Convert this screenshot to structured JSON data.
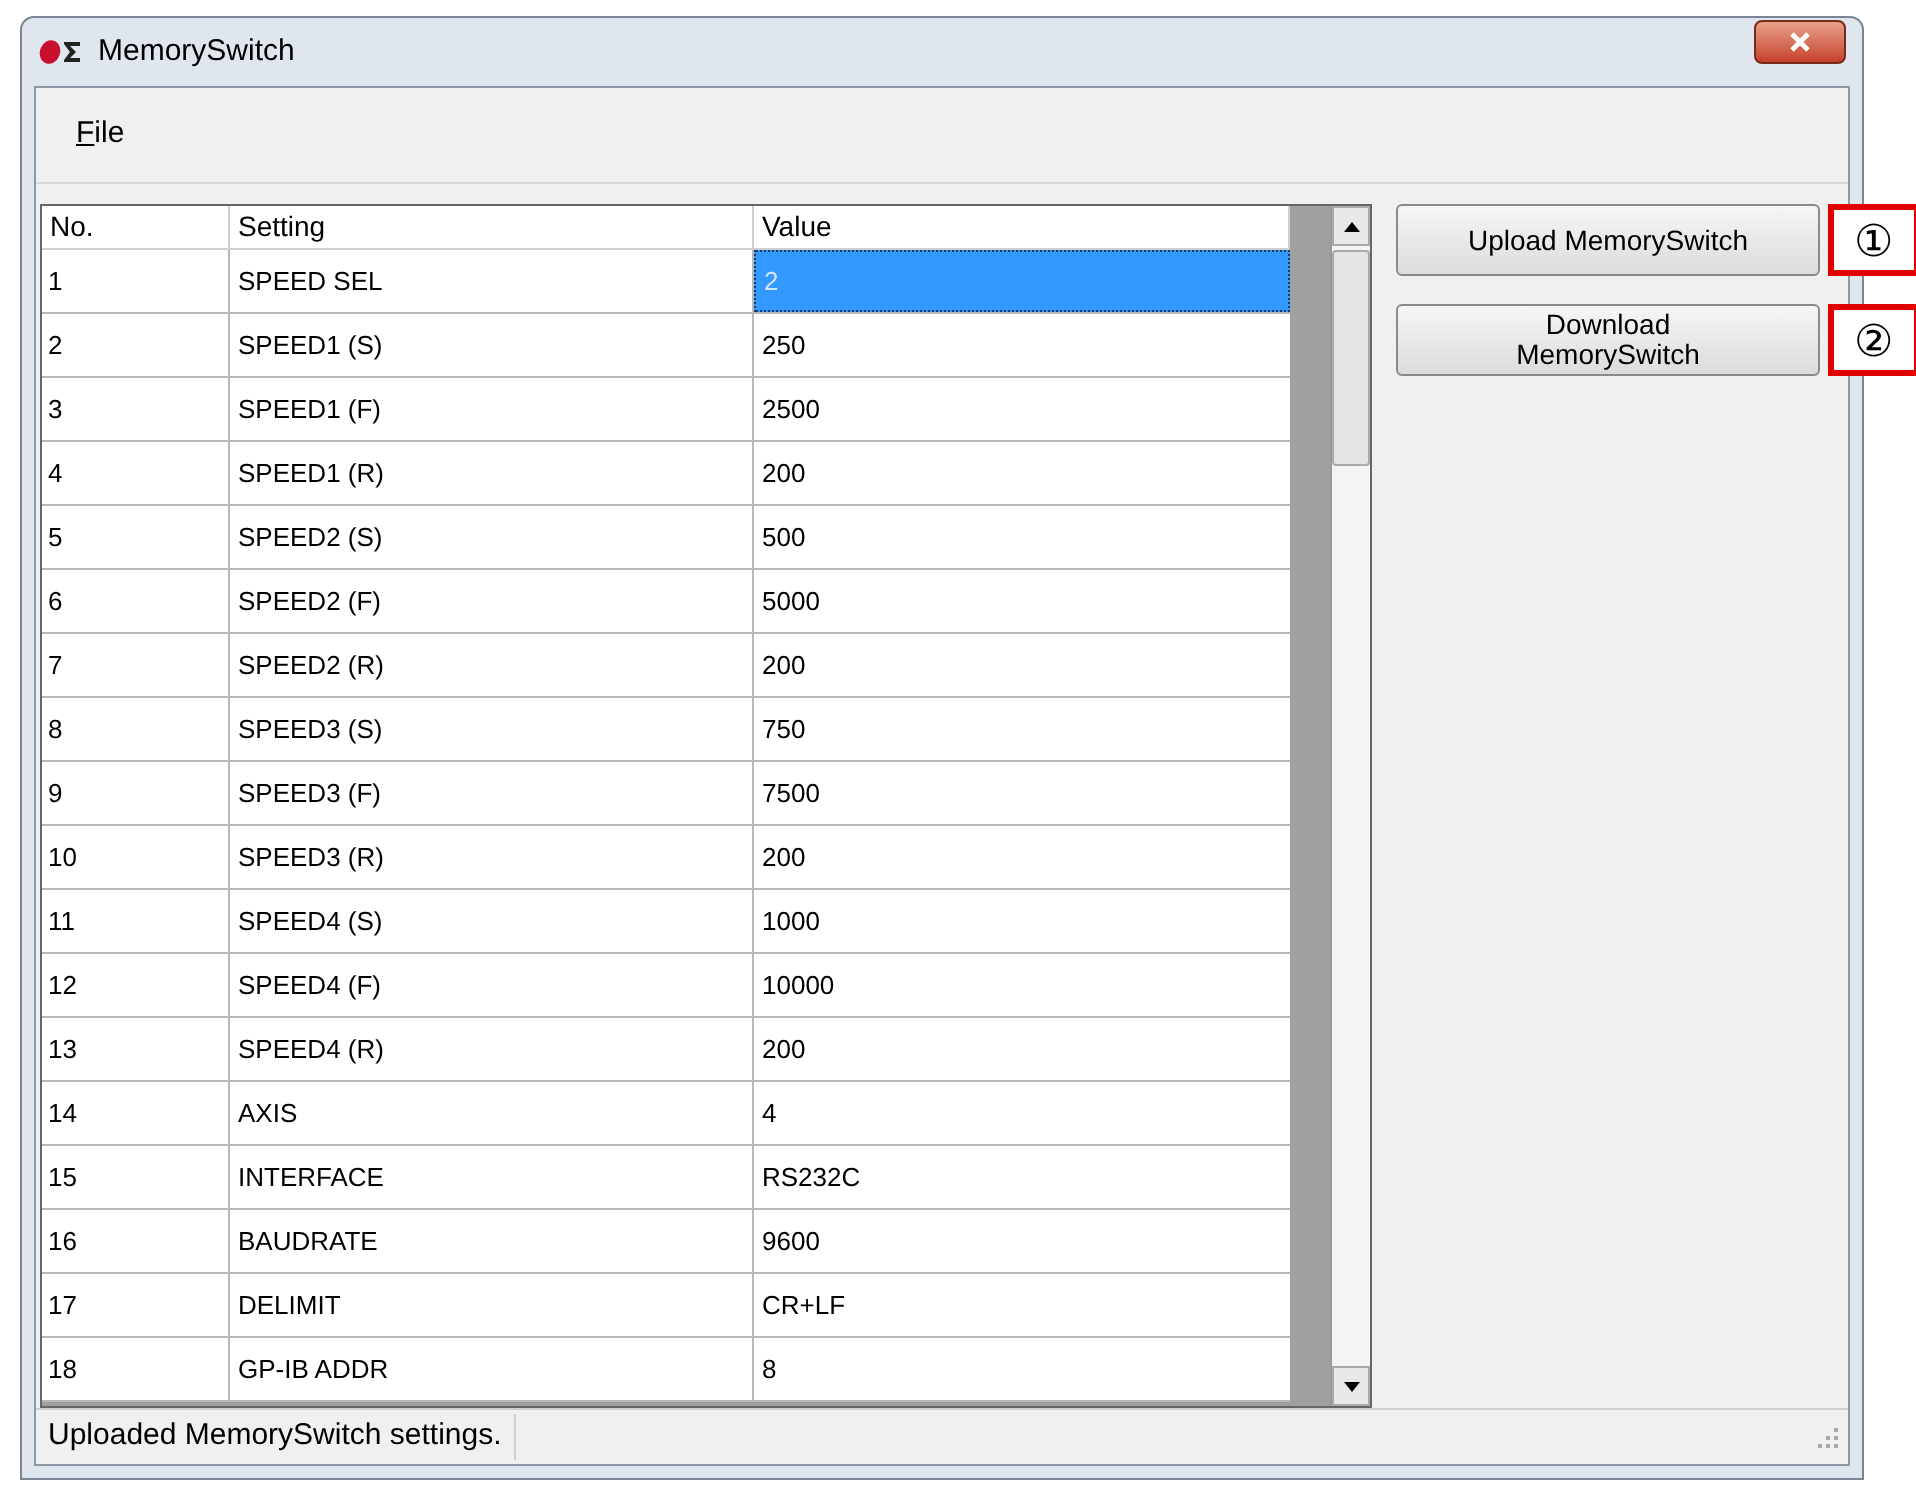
{
  "window": {
    "title": "MemorySwitch"
  },
  "menu": [
    {
      "label": "File"
    }
  ],
  "table": {
    "columns": [
      "No.",
      "Setting",
      "Value"
    ],
    "rows": [
      {
        "no": "1",
        "setting": "SPEED SEL",
        "value": "2",
        "selected": true
      },
      {
        "no": "2",
        "setting": "SPEED1 (S)",
        "value": "250",
        "selected": false
      },
      {
        "no": "3",
        "setting": "SPEED1 (F)",
        "value": "2500",
        "selected": false
      },
      {
        "no": "4",
        "setting": "SPEED1 (R)",
        "value": "200",
        "selected": false
      },
      {
        "no": "5",
        "setting": "SPEED2 (S)",
        "value": "500",
        "selected": false
      },
      {
        "no": "6",
        "setting": "SPEED2 (F)",
        "value": "5000",
        "selected": false
      },
      {
        "no": "7",
        "setting": "SPEED2 (R)",
        "value": "200",
        "selected": false
      },
      {
        "no": "8",
        "setting": "SPEED3 (S)",
        "value": "750",
        "selected": false
      },
      {
        "no": "9",
        "setting": "SPEED3 (F)",
        "value": "7500",
        "selected": false
      },
      {
        "no": "10",
        "setting": "SPEED3 (R)",
        "value": "200",
        "selected": false
      },
      {
        "no": "11",
        "setting": "SPEED4 (S)",
        "value": "1000",
        "selected": false
      },
      {
        "no": "12",
        "setting": "SPEED4 (F)",
        "value": "10000",
        "selected": false
      },
      {
        "no": "13",
        "setting": "SPEED4 (R)",
        "value": "200",
        "selected": false
      },
      {
        "no": "14",
        "setting": "AXIS",
        "value": "4",
        "selected": false
      },
      {
        "no": "15",
        "setting": "INTERFACE",
        "value": "RS232C",
        "selected": false
      },
      {
        "no": "16",
        "setting": "BAUDRATE",
        "value": "9600",
        "selected": false
      },
      {
        "no": "17",
        "setting": "DELIMIT",
        "value": "CR+LF",
        "selected": false
      },
      {
        "no": "18",
        "setting": "GP-IB ADDR",
        "value": "8",
        "selected": false
      }
    ]
  },
  "buttons": [
    {
      "label": "Upload MemorySwitch",
      "annotation": "①"
    },
    {
      "label": "Download MemorySwitch",
      "annotation": "②"
    }
  ],
  "status_bar": "Uploaded MemorySwitch settings."
}
